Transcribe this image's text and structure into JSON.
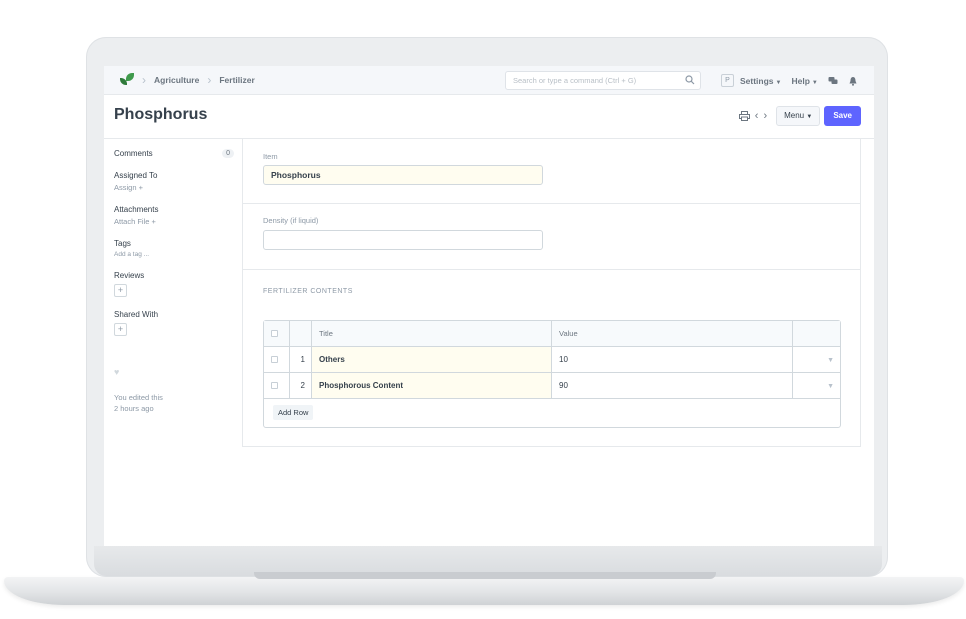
{
  "navbar": {
    "breadcrumbs": [
      "Agriculture",
      "Fertilizer"
    ],
    "search_placeholder": "Search or type a command (Ctrl + G)",
    "avatar_letter": "P",
    "settings_label": "Settings",
    "help_label": "Help"
  },
  "page": {
    "title": "Phosphorus",
    "menu_label": "Menu",
    "save_label": "Save",
    "accent_color": "#5e64ff"
  },
  "sidebar": {
    "comments_label": "Comments",
    "comments_count": "0",
    "assigned_to_label": "Assigned To",
    "assign_label": "Assign +",
    "attachments_label": "Attachments",
    "attach_file_label": "Attach File +",
    "tags_label": "Tags",
    "add_tag_label": "Add a tag ...",
    "reviews_label": "Reviews",
    "shared_with_label": "Shared With",
    "edit_note_line1": "You edited this",
    "edit_note_line2": "2 hours ago"
  },
  "form": {
    "item_label": "Item",
    "item_value": "Phosphorus",
    "density_label": "Density (if liquid)",
    "density_value": "",
    "contents_section_title": "FERTILIZER CONTENTS",
    "grid": {
      "columns": [
        "Title",
        "Value"
      ],
      "rows": [
        {
          "idx": "1",
          "title": "Others",
          "value": "10"
        },
        {
          "idx": "2",
          "title": "Phosphorous Content",
          "value": "90"
        }
      ],
      "add_row_label": "Add Row"
    }
  }
}
